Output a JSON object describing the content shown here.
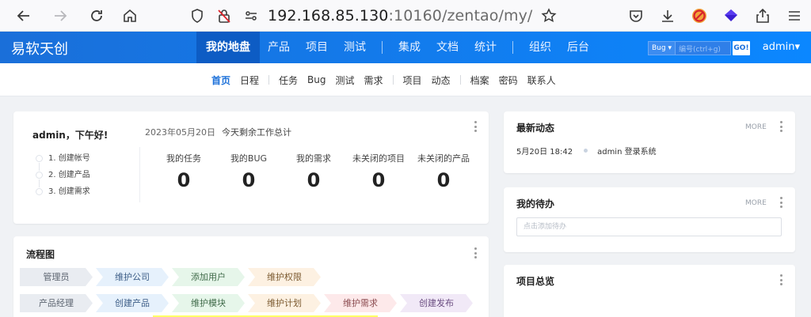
{
  "browser": {
    "url_host": "192.168.85.130",
    "url_rest": ":10160/zentao/my/"
  },
  "header": {
    "brand": "易软天创",
    "nav": [
      "我的地盘",
      "产品",
      "项目",
      "测试",
      "集成",
      "文档",
      "统计",
      "组织",
      "后台"
    ],
    "search_type": "Bug ▾",
    "search_placeholder": "编号(ctrl+g)",
    "search_go": "GO!",
    "user": "admin▾"
  },
  "subnav": [
    "首页",
    "日程",
    "任务",
    "Bug",
    "测试",
    "需求",
    "项目",
    "动态",
    "档案",
    "密码",
    "联系人"
  ],
  "welcome": {
    "greeting": "admin，下午好!",
    "date": "2023年05月20日",
    "date_text": "今天剩余工作总计",
    "steps": [
      "1. 创建帐号",
      "2. 创建产品",
      "3. 创建需求"
    ],
    "stats": [
      {
        "label": "我的任务",
        "value": "0"
      },
      {
        "label": "我的BUG",
        "value": "0"
      },
      {
        "label": "我的需求",
        "value": "0"
      },
      {
        "label": "未关闭的项目",
        "value": "0"
      },
      {
        "label": "未关闭的产品",
        "value": "0"
      }
    ]
  },
  "flow": {
    "title": "流程图",
    "row1": [
      "管理员",
      "维护公司",
      "添加用户",
      "维护权限"
    ],
    "row2": [
      "产品经理",
      "创建产品",
      "维护模块",
      "维护计划",
      "维护需求",
      "创建发布"
    ]
  },
  "dynamics": {
    "title": "最新动态",
    "more": "MORE",
    "time": "5月20日 18:42",
    "text": "admin 登录系统"
  },
  "todo": {
    "title": "我的待办",
    "more": "MORE",
    "placeholder": "点击添加待办"
  },
  "projects": {
    "title": "项目总览"
  }
}
